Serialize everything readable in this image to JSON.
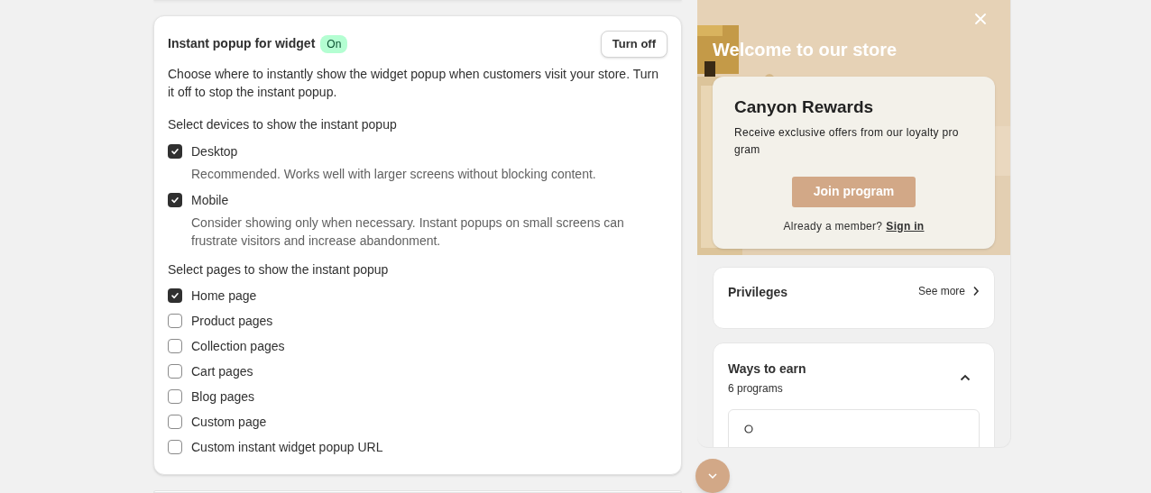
{
  "settings_card": {
    "title": "Instant popup for widget",
    "status_badge": "On",
    "toggle_button": "Turn off",
    "description": "Choose where to instantly show the widget popup when customers visit your store. Turn it off to stop the instant popup.",
    "devices": {
      "heading": "Select devices to show the instant popup",
      "options": [
        {
          "label": "Desktop",
          "checked": true,
          "help": "Recommended. Works well with larger screens without blocking content."
        },
        {
          "label": "Mobile",
          "checked": true,
          "help": "Consider showing only when necessary. Instant popups on small screens can frustrate visitors and increase abandonment."
        }
      ]
    },
    "pages": {
      "heading": "Select pages to show the instant popup",
      "options": [
        {
          "label": "Home page",
          "checked": true
        },
        {
          "label": "Product pages",
          "checked": false
        },
        {
          "label": "Collection pages",
          "checked": false
        },
        {
          "label": "Cart pages",
          "checked": false
        },
        {
          "label": "Blog pages",
          "checked": false
        },
        {
          "label": "Custom page",
          "checked": false
        },
        {
          "label": "Custom instant widget popup URL",
          "checked": false
        }
      ]
    }
  },
  "preview": {
    "hero": {
      "kind": "picture",
      "title": "Welcome to our store"
    },
    "rewards_card": {
      "title": "Canyon Rewards",
      "text": "Receive exclusive offers from our loyalty pro gram",
      "button": "Join program",
      "member_prompt": "Already a member?",
      "sign_in": "Sign in"
    },
    "privileges": {
      "title": "Privileges",
      "link": "See more"
    },
    "ways_to_earn": {
      "title": "Ways to earn",
      "count": "6 programs",
      "expanded": true
    }
  }
}
